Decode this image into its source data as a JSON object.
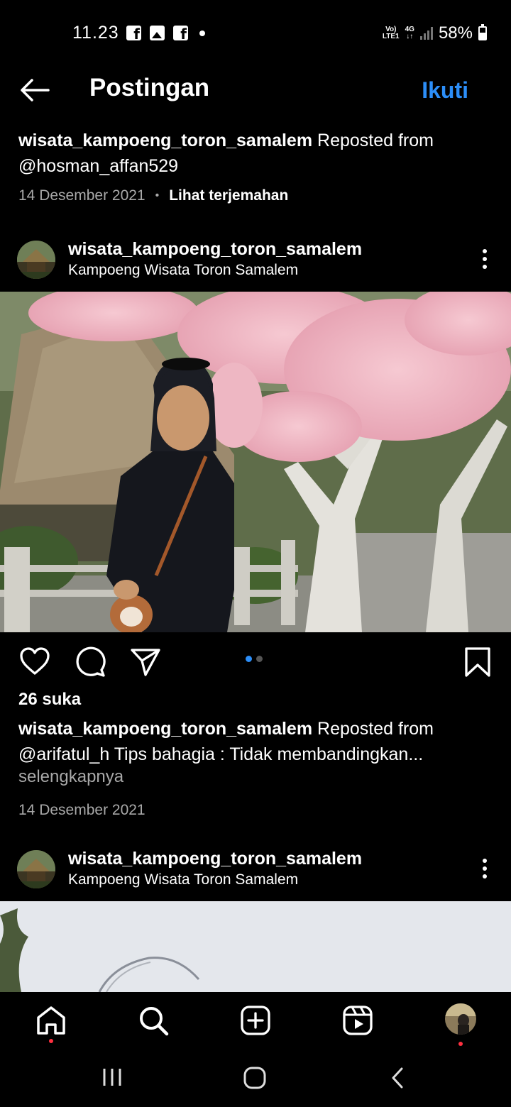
{
  "status_bar": {
    "time": "11.23",
    "network_top": "Vo)",
    "network_bottom": "LTE1",
    "net_type": "4G",
    "battery": "58%"
  },
  "header": {
    "title": "Postingan",
    "follow_label": "Ikuti"
  },
  "caption_top": {
    "username": "wisata_kampoeng_toron_samalem",
    "text": " Reposted from @hosman_affan529",
    "date": "14 Desember 2021",
    "translate_label": "Lihat terjemahan"
  },
  "post1": {
    "username": "wisata_kampoeng_toron_samalem",
    "location": "Kampoeng Wisata Toron Samalem",
    "likes": "26 suka",
    "caption_username": "wisata_kampoeng_toron_samalem",
    "caption_text": " Reposted from @arifatul_h Tips bahagia : Tidak membandingkan...",
    "more_label": "selengkapnya",
    "date": "14 Desember 2021",
    "carousel_total": 2,
    "carousel_active": 1
  },
  "post2": {
    "username": "wisata_kampoeng_toron_samalem",
    "location": "Kampoeng Wisata Toron Samalem"
  },
  "icons": {
    "back": "arrow-left-icon",
    "like": "heart-icon",
    "comment": "comment-icon",
    "share": "send-icon",
    "save": "bookmark-icon",
    "home": "home-icon",
    "search": "search-icon",
    "create": "plus-square-icon",
    "reels": "reels-icon"
  },
  "colors": {
    "accent": "#2c8ef8",
    "background": "#000000",
    "secondary_text": "#a8a8a8",
    "notification": "#ff3040"
  }
}
